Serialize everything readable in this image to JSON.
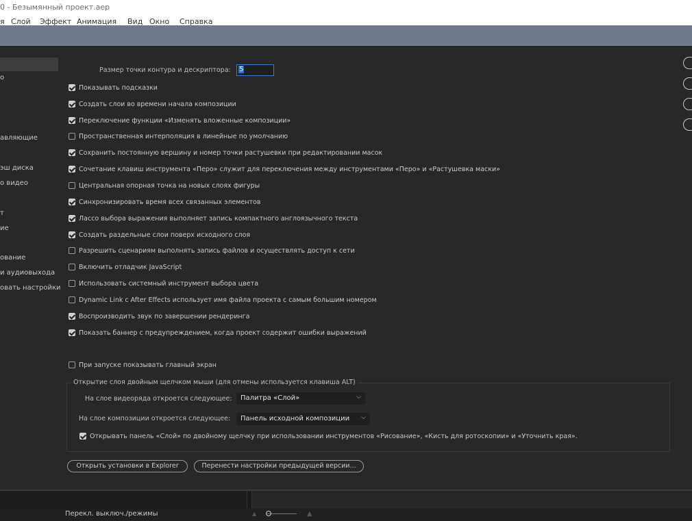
{
  "window": {
    "title": "0 - Безымянный проект.aep",
    "menu": [
      "я",
      "Слой",
      "Эффект",
      "Анимация",
      "Вид",
      "Окно",
      "Справка"
    ]
  },
  "sidebar": {
    "items": [
      {
        "label": "",
        "selected": true
      },
      {
        "label": "о"
      },
      {
        "label": "авляющие"
      },
      {
        "label": "эш диска"
      },
      {
        "label": "о видео"
      },
      {
        "label": "т"
      },
      {
        "label": "ие"
      },
      {
        "label": "ование"
      },
      {
        "label": "и аудиовыхода"
      },
      {
        "label": "овать настройки"
      }
    ]
  },
  "general": {
    "point_size_label": "Размер точки контура и дескриптора:",
    "point_size_value": "5",
    "checkboxes": [
      {
        "label": "Показывать подсказки",
        "checked": true
      },
      {
        "label": "Создать слои во времени начала композиции",
        "checked": true
      },
      {
        "label": "Переключение функции «Изменять вложенные композиции»",
        "checked": true
      },
      {
        "label": "Пространственная интерполяция в линейные по умолчанию",
        "checked": false
      },
      {
        "label": "Сохранить постоянную вершину и номер точки растушевки при редактировании масок",
        "checked": true
      },
      {
        "label": "Сочетание клавиш инструмента «Перо» служит для переключения между инструментами «Перо» и «Растушевка маски»",
        "checked": true
      },
      {
        "label": "Центральная опорная точка на новых слоях фигуры",
        "checked": false
      },
      {
        "label": "Синхронизировать время всех связанных элементов",
        "checked": true
      },
      {
        "label": "Лассо выбора выражения выполняет запись компактного англоязычного текста",
        "checked": true
      },
      {
        "label": "Создать раздельные слои поверх исходного слоя",
        "checked": true
      },
      {
        "label": "Разрешить сценариям выполнять запись файлов и осуществлять доступ к сети",
        "checked": false
      },
      {
        "label": "Включить отладчик JavaScript",
        "checked": false
      },
      {
        "label": "Использовать системный инструмент выбора цвета",
        "checked": false
      },
      {
        "label": "Dynamic Link с After Effects использует имя файла проекта с самым большим номером",
        "checked": false
      },
      {
        "label": "Воспроизводить звук по завершении рендеринга",
        "checked": true
      },
      {
        "label": "Показать баннер с предупреждением, когда проект содержит ошибки выражений",
        "checked": true
      }
    ],
    "show_home": {
      "label": "При запуске показывать главный экран",
      "checked": false
    }
  },
  "double_click_group": {
    "title": "Открытие слоя двойным щелчком мыши (для отмены используется клавиша ALT)",
    "footage_label": "На слое видеоряда откроется следующее:",
    "footage_value": "Палитра «Слой»",
    "comp_label": "На слое композиции откроется следующее:",
    "comp_value": "Панель исходной композиции",
    "open_layer_panel": {
      "label": "Открывать панель «Слой» по двойному щелчку при использовании инструментов «Рисование», «Кисть для ротоскопии» и «Уточнить края».",
      "checked": true
    }
  },
  "buttons": {
    "reveal": "Открыть установки в Explorer",
    "migrate": "Перенести настройки предыдущей версии..."
  },
  "footer": {
    "mode_label": "Перекл. выключ./режимы"
  }
}
